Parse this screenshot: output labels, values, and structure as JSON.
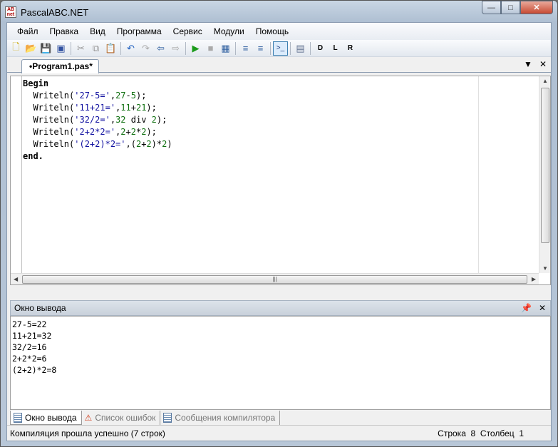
{
  "window": {
    "title": "PascalABC.NET",
    "icon_text": "AB\nnet"
  },
  "menu": [
    "Файл",
    "Правка",
    "Вид",
    "Программа",
    "Сервис",
    "Модули",
    "Помощь"
  ],
  "editor_tab": {
    "label": "•Program1.pas*"
  },
  "code": [
    [
      {
        "t": "Begin",
        "c": "kw"
      }
    ],
    [
      {
        "t": "  Writeln(",
        "c": "id"
      },
      {
        "t": "'27-5='",
        "c": "str"
      },
      {
        "t": ",",
        "c": "id"
      },
      {
        "t": "27",
        "c": "num"
      },
      {
        "t": "-",
        "c": "id"
      },
      {
        "t": "5",
        "c": "num"
      },
      {
        "t": ");",
        "c": "id"
      }
    ],
    [
      {
        "t": "  Writeln(",
        "c": "id"
      },
      {
        "t": "'11+21='",
        "c": "str"
      },
      {
        "t": ",",
        "c": "id"
      },
      {
        "t": "11",
        "c": "num"
      },
      {
        "t": "+",
        "c": "id"
      },
      {
        "t": "21",
        "c": "num"
      },
      {
        "t": ");",
        "c": "id"
      }
    ],
    [
      {
        "t": "  Writeln(",
        "c": "id"
      },
      {
        "t": "'32/2='",
        "c": "str"
      },
      {
        "t": ",",
        "c": "id"
      },
      {
        "t": "32",
        "c": "num"
      },
      {
        "t": " div ",
        "c": "id"
      },
      {
        "t": "2",
        "c": "num"
      },
      {
        "t": ");",
        "c": "id"
      }
    ],
    [
      {
        "t": "  Writeln(",
        "c": "id"
      },
      {
        "t": "'2+2*2='",
        "c": "str"
      },
      {
        "t": ",",
        "c": "id"
      },
      {
        "t": "2",
        "c": "num"
      },
      {
        "t": "+",
        "c": "id"
      },
      {
        "t": "2",
        "c": "num"
      },
      {
        "t": "*",
        "c": "id"
      },
      {
        "t": "2",
        "c": "num"
      },
      {
        "t": ");",
        "c": "id"
      }
    ],
    [
      {
        "t": "  Writeln(",
        "c": "id"
      },
      {
        "t": "'(2+2)*2='",
        "c": "str"
      },
      {
        "t": ",(",
        "c": "id"
      },
      {
        "t": "2",
        "c": "num"
      },
      {
        "t": "+",
        "c": "id"
      },
      {
        "t": "2",
        "c": "num"
      },
      {
        "t": ")*",
        "c": "id"
      },
      {
        "t": "2",
        "c": "num"
      },
      {
        "t": ")",
        "c": "id"
      }
    ],
    [
      {
        "t": "end.",
        "c": "kw"
      }
    ]
  ],
  "output_panel": {
    "title": "Окно вывода",
    "lines": [
      "27-5=22",
      "11+21=32",
      "32/2=16",
      "2+2*2=6",
      "(2+2)*2=8"
    ]
  },
  "bottom_tabs": [
    "Окно вывода",
    "Список ошибок",
    "Сообщения компилятора"
  ],
  "status": {
    "message": "Компиляция прошла успешно (7 строк)",
    "row_label": "Строка",
    "row": "8",
    "col_label": "Столбец",
    "col": "1"
  }
}
